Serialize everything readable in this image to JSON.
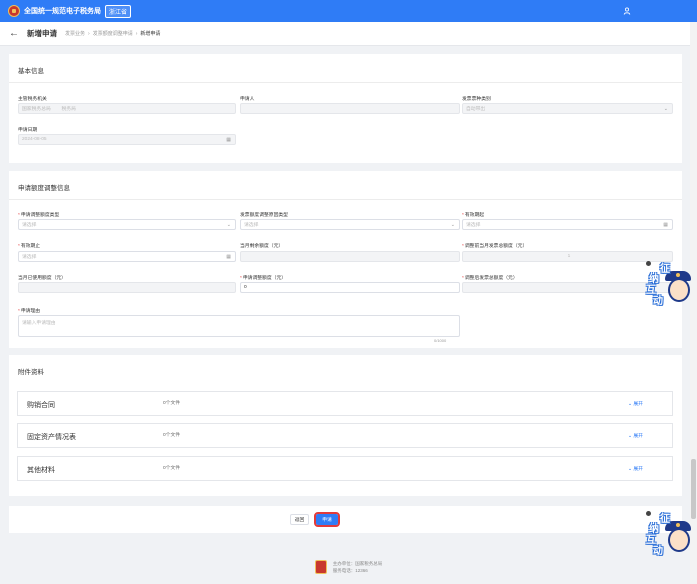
{
  "topbar": {
    "title": "全国统一规范电子税务局",
    "badge": "浙江省"
  },
  "header": {
    "back_icon": "arrow-left-icon",
    "title": "新增申请",
    "breadcrumbs": [
      "发票业务",
      "发票额度调整申请",
      "新增申请"
    ]
  },
  "basic": {
    "title": "基本信息",
    "tax_authority": {
      "label": "主管税务机关",
      "placeholder": "国家税务总局",
      "value": "税务局"
    },
    "applicant": {
      "label": "申请人"
    },
    "invoice_type": {
      "label": "发票票种类别",
      "placeholder": "自动带出"
    },
    "apply_date": {
      "label": "申请日期",
      "value": "2024-08-05"
    }
  },
  "quota": {
    "title": "申请额度调整信息",
    "adjust_type": {
      "label": "申请调整额度类型",
      "placeholder": "请选择"
    },
    "reason_type": {
      "label": "发票额度调整原因类型",
      "placeholder": "请选择"
    },
    "valid_from": {
      "label": "有效期起",
      "placeholder": "请选择"
    },
    "valid_to": {
      "label": "有效期止",
      "placeholder": "请选择"
    },
    "remaining": {
      "label": "当月剩余额度（元）"
    },
    "total_before": {
      "label": "调整前当月发票总额度（元）",
      "value": "1"
    },
    "used": {
      "label": "当月已使用额度（元）"
    },
    "adjust_amount": {
      "label": "申请调整额度（元）",
      "value": "0"
    },
    "total_after": {
      "label": "调整后发票总额度（元）"
    },
    "reason": {
      "label": "申请理由",
      "placeholder": "请输入申请理由",
      "counter": "0/1000"
    }
  },
  "attachments": {
    "title": "附件资料",
    "expand_label": "展开",
    "items": [
      {
        "name": "购销合同",
        "count": "0个文件"
      },
      {
        "name": "固定资产情况表",
        "count": "0个文件"
      },
      {
        "name": "其他材料",
        "count": "0个文件"
      }
    ]
  },
  "actions": {
    "back": "返回",
    "apply": "申请"
  },
  "helper": {
    "chars": [
      "征",
      "纳",
      "互",
      "动"
    ]
  },
  "footer": {
    "line1": "主办单位：国家税务总局",
    "line2": "服务电话：12366"
  },
  "colors": {
    "primary": "#2f7cf6",
    "required": "#e23b3b",
    "highlight_border": "#e23b3b"
  }
}
